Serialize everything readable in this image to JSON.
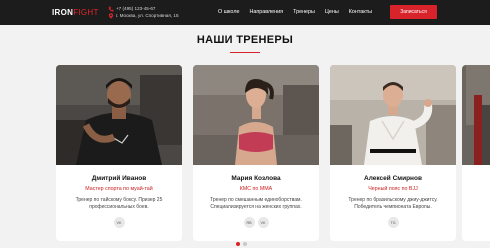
{
  "header": {
    "logo_part1": "IRON",
    "logo_part2": "FIGHT",
    "phone": "+7 (495) 123-45-67",
    "address": "г. Москва, ул. Спортивная, 15",
    "nav": [
      "О школе",
      "Направления",
      "Тренеры",
      "Цены",
      "Контакты"
    ],
    "signup_label": "Записаться"
  },
  "section_title": "НАШИ ТРЕНЕРЫ",
  "trainers": [
    {
      "name": "Дмитрий Иванов",
      "rank": "Мастер спорта по муай-тай",
      "desc_line1": "Тренер по тайскому боксу. Призер 25",
      "desc_line2": "профессиональных боев.",
      "socials": [
        "VK"
      ]
    },
    {
      "name": "Мария Козлова",
      "rank": "КМС по MMA",
      "desc_line1": "Тренер по смешанным единоборствам.",
      "desc_line2": "Специализируется на женских группах.",
      "socials": [
        "RB",
        "VK"
      ]
    },
    {
      "name": "Алексей Смирнов",
      "rank": "Черный пояс по BJJ",
      "desc_line1": "Тренер по бразильскому джиу-джитсу.",
      "desc_line2": "Победитель чемпионата Европы.",
      "socials": [
        "TG"
      ]
    }
  ],
  "carousel": {
    "slides": 2,
    "active": 1
  },
  "colors": {
    "accent": "#d8232a",
    "header_bg": "#1c1c1c"
  },
  "icons": {
    "phone": "phone-icon",
    "location": "location-pin-icon"
  }
}
